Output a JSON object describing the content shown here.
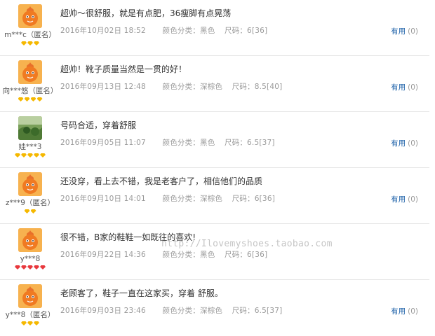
{
  "reviews": [
    {
      "avatar": "orange-mascot",
      "user": "m***c（匿名）",
      "badge_color": "#f5b800",
      "badge_count": 3,
      "text": "超帅～很舒服，就是有点肥，36瘦脚有点晃荡",
      "date": "2016年10月02日 18:52",
      "color_label": "颜色分类：黑色",
      "size_label": "尺码：6[36]",
      "helpful_label": "有用",
      "helpful_count": "(0)"
    },
    {
      "avatar": "orange-mascot",
      "user": "向***悠（匿名）",
      "badge_color": "#f5b800",
      "badge_count": 4,
      "text": "超帅！靴子质量当然是一贯的好！",
      "date": "2016年09月13日 12:48",
      "color_label": "颜色分类：深棕色",
      "size_label": "尺码：8.5[40]",
      "helpful_label": "有用",
      "helpful_count": "(0)"
    },
    {
      "avatar": "nature-photo",
      "user": "娃***3",
      "badge_color": "#f5b800",
      "badge_count": 5,
      "text": "号码合适，穿着舒服",
      "date": "2016年09月05日 11:07",
      "color_label": "颜色分类：黑色",
      "size_label": "尺码：6.5[37]",
      "helpful_label": "有用",
      "helpful_count": "(0)"
    },
    {
      "avatar": "orange-mascot",
      "user": "z***9（匿名）",
      "badge_color": "#f5b800",
      "badge_count": 2,
      "text": "还没穿，看上去不错，我是老客户了，相信他们的品质",
      "date": "2016年09月10日 14:01",
      "color_label": "颜色分类：深棕色",
      "size_label": "尺码：6[36]",
      "helpful_label": "有用",
      "helpful_count": "(0)"
    },
    {
      "avatar": "orange-mascot",
      "user": "y***8",
      "badge_color": "#e8383d",
      "badge_count": 5,
      "text": "很不错，B家的鞋鞋一如既往的喜欢!",
      "date": "2016年09月22日 14:36",
      "color_label": "颜色分类：黑色",
      "size_label": "尺码：6[36]",
      "helpful_label": "",
      "helpful_count": ""
    },
    {
      "avatar": "orange-mascot",
      "user": "y***8（匿名）",
      "badge_color": "#f5b800",
      "badge_count": 3,
      "text": "老顾客了，鞋子一直在这家买，穿着 舒服。",
      "date": "2016年09月03日 23:46",
      "color_label": "颜色分类：深棕色",
      "size_label": "尺码：6.5[37]",
      "helpful_label": "有用",
      "helpful_count": "(0)"
    }
  ],
  "watermark": "http://Ilovemyshoes.taobao.com"
}
